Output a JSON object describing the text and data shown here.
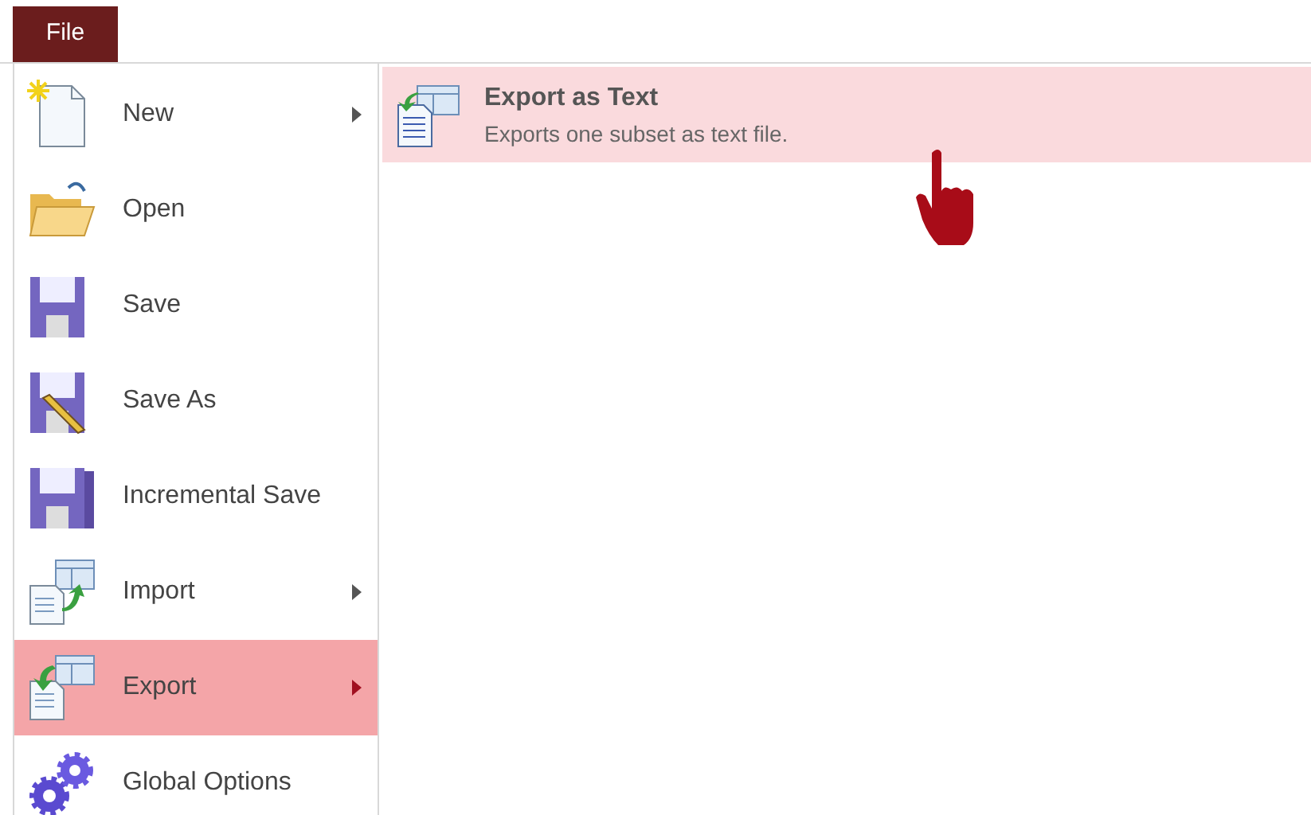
{
  "menu_bar": {
    "tabs": [
      {
        "label": "File",
        "selected": true
      }
    ]
  },
  "file_menu": {
    "items": [
      {
        "kind": "new",
        "label": "New",
        "submenu": true,
        "selected": false
      },
      {
        "kind": "open",
        "label": "Open",
        "submenu": false,
        "selected": false
      },
      {
        "kind": "save",
        "label": "Save",
        "submenu": false,
        "selected": false
      },
      {
        "kind": "saveas",
        "label": "Save As",
        "submenu": false,
        "selected": false
      },
      {
        "kind": "incremental",
        "label": "Incremental Save",
        "submenu": false,
        "selected": false
      },
      {
        "kind": "import",
        "label": "Import",
        "submenu": true,
        "selected": false
      },
      {
        "kind": "export",
        "label": "Export",
        "submenu": true,
        "selected": true
      },
      {
        "kind": "options",
        "label": "Global Options",
        "submenu": false,
        "selected": false
      }
    ]
  },
  "submenu": {
    "items": [
      {
        "title": "Export as Text",
        "description": "Exports one subset as text file.",
        "selected": true
      }
    ]
  }
}
